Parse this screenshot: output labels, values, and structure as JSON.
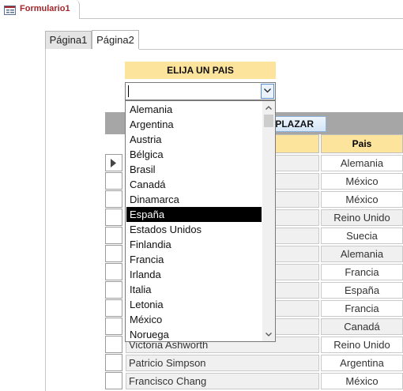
{
  "document": {
    "tab_title": "Formulario1"
  },
  "page_tabs": {
    "tab1": "Página1",
    "tab2": "Página2",
    "active": "Página2"
  },
  "country_selector": {
    "header": "ELIJA UN PAIS",
    "value": "",
    "options": [
      "Alemania",
      "Argentina",
      "Austria",
      "Bélgica",
      "Brasil",
      "Canadá",
      "Dinamarca",
      "España",
      "Estados Unidos",
      "Finlandia",
      "Francia",
      "Irlanda",
      "Italia",
      "Letonia",
      "México",
      "Noruega"
    ],
    "highlighted": "España"
  },
  "replace_button": {
    "label_visible": "IPLAZAR"
  },
  "datasheet": {
    "column_pais": "Pais",
    "rows": [
      {
        "nombre": "",
        "pais": "Alemania"
      },
      {
        "nombre": "",
        "pais": "México"
      },
      {
        "nombre": "",
        "pais": "México"
      },
      {
        "nombre": "",
        "pais": "Reino Unido"
      },
      {
        "nombre": "",
        "pais": "Suecia"
      },
      {
        "nombre": "",
        "pais": "Alemania"
      },
      {
        "nombre": "",
        "pais": "Francia"
      },
      {
        "nombre": "",
        "pais": "España"
      },
      {
        "nombre": "",
        "pais": "Francia"
      },
      {
        "nombre": "",
        "pais": "Canadá"
      },
      {
        "nombre": "Victoria Ashworth",
        "pais": "Reino Unido"
      },
      {
        "nombre": "Patricio Simpson",
        "pais": "Argentina"
      },
      {
        "nombre": "Francisco Chang",
        "pais": "México"
      }
    ]
  },
  "colors": {
    "header_fill": "#fde49c",
    "doc_tab_title": "#a4262c",
    "selection": "#000000"
  }
}
